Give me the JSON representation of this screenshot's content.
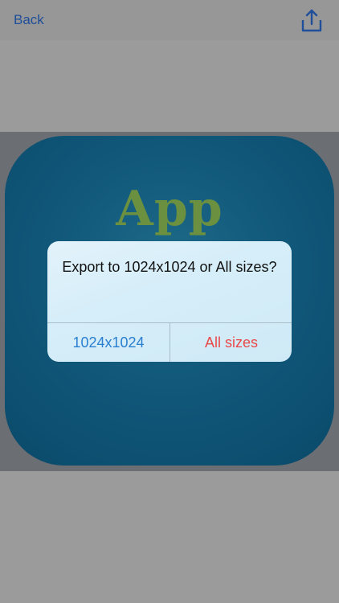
{
  "navbar": {
    "back_label": "Back",
    "share_icon": "share-upload-icon"
  },
  "preview": {
    "icon_text": "App",
    "icon_text_color": "#6a9040",
    "icon_background": "#11587a"
  },
  "alert": {
    "message": "Export to 1024x1024 or All sizes?",
    "buttons": [
      {
        "label": "1024x1024",
        "color": "#2a7fd0"
      },
      {
        "label": "All sizes",
        "color": "#e8484a"
      }
    ]
  }
}
